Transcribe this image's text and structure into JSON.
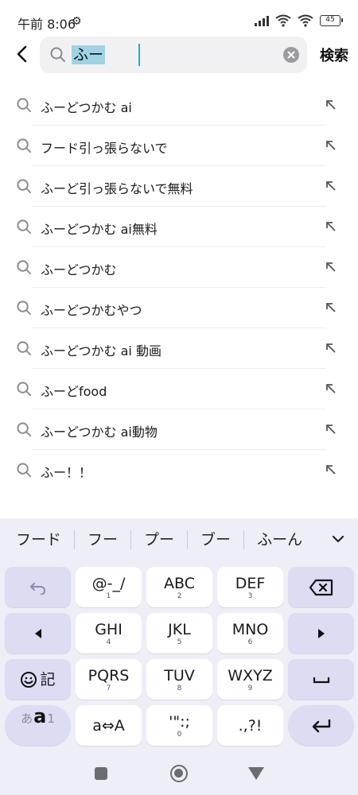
{
  "status": {
    "time": "午前 8:06",
    "battery": "45"
  },
  "search": {
    "query": "ふー",
    "submit_label": "検索"
  },
  "suggestions": [
    "ふーどつかむ ai",
    "フード引っ張らないで",
    "ふーど引っ張らないで無料",
    "ふーどつかむ ai無料",
    "ふーどつかむ",
    "ふーどつかむやつ",
    "ふーどつかむ ai 動画",
    "ふーどfood",
    "ふーどつかむ ai動物",
    "ふー！！"
  ],
  "keyboard": {
    "candidates": [
      "フード",
      "フー",
      "プー",
      "ブー",
      "ふーん"
    ],
    "keys": {
      "undo_icon": "undo-icon",
      "k1": {
        "main": "@-_/",
        "sub": "1"
      },
      "k2": {
        "main": "ABC",
        "sub": "2"
      },
      "k3": {
        "main": "DEF",
        "sub": "3"
      },
      "k4": {
        "main": "GHI",
        "sub": "4"
      },
      "k5": {
        "main": "JKL",
        "sub": "5"
      },
      "k6": {
        "main": "MNO",
        "sub": "6"
      },
      "k7": {
        "main": "PQRS",
        "sub": "7"
      },
      "k8": {
        "main": "TUV",
        "sub": "8"
      },
      "k9": {
        "main": "WXYZ",
        "sub": "9"
      },
      "k0": {
        "main": "'\":;",
        "sub": "0"
      },
      "emoji_label": "記",
      "case_label": "a⇔A",
      "punct_label": ".,?!",
      "mode_main": "a",
      "mode_left": "あ",
      "mode_right": "1"
    }
  },
  "colors": {
    "accent": "#2aa6c8",
    "key_fn": "#dcdcf3",
    "keyboard_bg": "#eeeef7"
  }
}
